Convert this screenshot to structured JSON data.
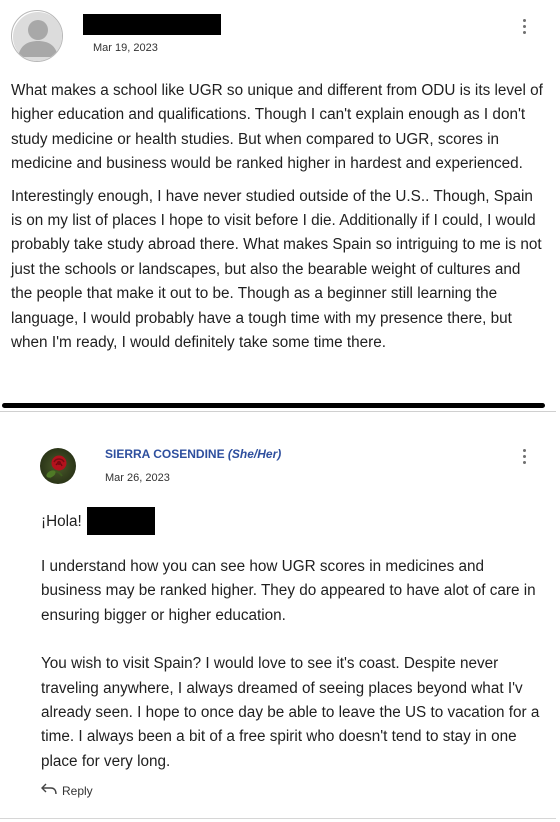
{
  "post1": {
    "date": "Mar 19, 2023",
    "paragraphs": [
      "What makes a school like UGR so unique and different from ODU is its level of higher education and qualifications. Though I can't explain enough as I don't study medicine or health studies. But when compared to UGR, scores in medicine and business would be ranked higher in hardest and experienced.",
      "Interestingly enough, I have never studied outside of the U.S.. Though, Spain is on my list of places I hope to visit before I die. Additionally if I could, I would probably take study abroad there. What makes Spain so intriguing to me is not just the schools or landscapes, but also the bearable weight of cultures and the people that make it out to be. Though as a beginner still learning the language, I would probably have a tough time with my presence there, but when I'm ready, I would definitely take some time there."
    ]
  },
  "post2": {
    "author": "SIERRA COSENDINE",
    "pronouns": "(She/Her)",
    "date": "Mar 26, 2023",
    "greeting": "¡Hola!",
    "paragraphs": [
      "I understand how you can see how UGR scores in medicines and business may be ranked higher. They do appeared to have alot of care in ensuring bigger or higher education.",
      "You wish to visit Spain? I would love to see it's coast. Despite never traveling anywhere, I always dreamed of seeing places beyond what I'v already seen. I hope to once day be able to leave the US to vacation for a time. I always been a bit of a free spirit who doesn't tend to stay in one place for very long."
    ],
    "reply_label": "Reply"
  },
  "icons": {
    "avatar_default": "default-user-icon",
    "avatar_rose": "rose-avatar",
    "more": "kebab-menu-icon",
    "reply": "reply-arrow-icon"
  }
}
